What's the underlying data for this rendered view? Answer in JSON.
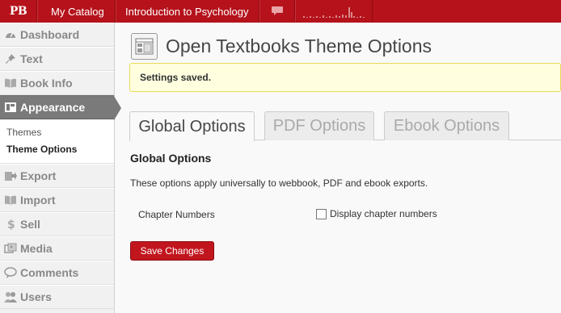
{
  "adminbar": {
    "logo": "PB",
    "catalog": "My Catalog",
    "book_title": "Introduction to Psychology",
    "comments_icon": "speech-bubble-icon",
    "stats_icon": "sparkline-icon",
    "brand_color": "#b5121b"
  },
  "sidebar": {
    "items": [
      {
        "label": "Dashboard",
        "icon": "dashboard-icon"
      },
      {
        "label": "Text",
        "icon": "pin-icon"
      },
      {
        "label": "Book Info",
        "icon": "book-icon"
      },
      {
        "label": "Appearance",
        "icon": "appearance-icon",
        "active": true
      },
      {
        "label": "Export",
        "icon": "export-icon"
      },
      {
        "label": "Import",
        "icon": "import-icon"
      },
      {
        "label": "Sell",
        "icon": "dollar-icon"
      },
      {
        "label": "Media",
        "icon": "media-icon"
      },
      {
        "label": "Comments",
        "icon": "comment-icon"
      },
      {
        "label": "Users",
        "icon": "users-icon"
      }
    ],
    "submenu": [
      {
        "label": "Themes"
      },
      {
        "label": "Theme Options",
        "current": true
      }
    ]
  },
  "main": {
    "title": "Open Textbooks Theme Options",
    "notice": "Settings saved.",
    "tabs": [
      {
        "label": "Global Options",
        "active": true
      },
      {
        "label": "PDF Options"
      },
      {
        "label": "Ebook Options"
      }
    ],
    "section_title": "Global Options",
    "description": "These options apply universally to webbook, PDF and ebook exports.",
    "field_label": "Chapter Numbers",
    "checkbox_label": "Display chapter numbers",
    "checkbox_checked": false,
    "save_label": "Save Changes"
  }
}
